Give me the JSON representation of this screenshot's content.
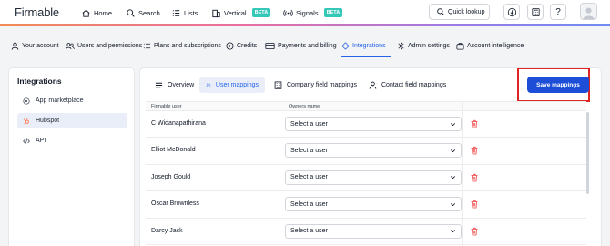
{
  "colors": {
    "accent": "#2563eb",
    "primary_button": "#1d4ed8",
    "beta_badge": "#35c7b7",
    "highlight": "#e02424",
    "delete": "#ef4444"
  },
  "header": {
    "logo": "Firmable",
    "nav": [
      {
        "label": "Home",
        "icon": "home-icon"
      },
      {
        "label": "Search",
        "icon": "search-icon"
      },
      {
        "label": "Lists",
        "icon": "list-icon"
      },
      {
        "label": "Vertical",
        "icon": "building-icon",
        "badge": "BETA"
      },
      {
        "label": "Signals",
        "icon": "signal-icon",
        "badge": "BETA"
      }
    ],
    "quick_lookup": "Quick lookup"
  },
  "settings_nav": {
    "items": [
      {
        "label": "Your account",
        "icon": "user-icon"
      },
      {
        "label": "Users and permissions",
        "icon": "users-icon"
      },
      {
        "label": "Plans and subscriptions",
        "icon": "plans-icon"
      },
      {
        "label": "Credits",
        "icon": "credits-icon"
      },
      {
        "label": "Payments and billing",
        "icon": "card-icon"
      },
      {
        "label": "Integrations",
        "icon": "integrations-icon",
        "active": true
      },
      {
        "label": "Admin settings",
        "icon": "gear-icon"
      },
      {
        "label": "Account intelligence",
        "icon": "briefcase-icon"
      }
    ]
  },
  "sidebar": {
    "title": "Integrations",
    "items": [
      {
        "label": "App marketplace",
        "icon": "marketplace-icon"
      },
      {
        "label": "Hubspot",
        "icon": "hubspot-icon",
        "active": true
      },
      {
        "label": "API",
        "icon": "code-icon"
      }
    ]
  },
  "main": {
    "tabs": [
      {
        "label": "Overview",
        "icon": "menu-icon"
      },
      {
        "label": "User mappings",
        "icon": "users-icon",
        "active": true
      },
      {
        "label": "Company field mappings",
        "icon": "building-icon"
      },
      {
        "label": "Contact field mappings",
        "icon": "user-icon"
      }
    ],
    "save_button": "Save mappings",
    "table": {
      "columns": [
        "Firmable user",
        "Owners name"
      ],
      "rows": [
        {
          "user": "C Widanapathirana",
          "owner": "Select a user"
        },
        {
          "user": "Elliot McDonald",
          "owner": "Select a user"
        },
        {
          "user": "Joseph Gould",
          "owner": "Select a user"
        },
        {
          "user": "Oscar Brownless",
          "owner": "Select a user"
        },
        {
          "user": "Darcy Jack",
          "owner": "Select a user"
        }
      ]
    }
  }
}
